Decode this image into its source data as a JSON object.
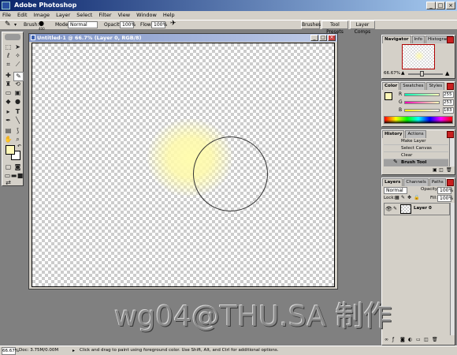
{
  "app": {
    "title": "Adobe Photoshop"
  },
  "window_controls": {
    "minimize": "_",
    "maximize": "□",
    "close": "×"
  },
  "menu": [
    "File",
    "Edit",
    "Image",
    "Layer",
    "Select",
    "Filter",
    "View",
    "Window",
    "Help"
  ],
  "options": {
    "brush_label": "Brush:",
    "brush_size": "400",
    "mode_label": "Mode:",
    "mode_value": "Normal",
    "opacity_label": "Opacity:",
    "opacity_value": "100%",
    "flow_label": "Flow:",
    "flow_value": "100%",
    "well_tabs": [
      "Brushes",
      "Tool Presets",
      "Layer Comps"
    ]
  },
  "document": {
    "title": "Untitled-1 @ 66.7% (Layer 0, RGB/8)"
  },
  "colors": {
    "foreground": "#fff8b8",
    "background": "#ffffff"
  },
  "navigator": {
    "tabs": [
      "Navigator",
      "Info",
      "Histogram"
    ],
    "zoom": "66.67%"
  },
  "color_panel": {
    "tabs": [
      "Color",
      "Swatches",
      "Styles"
    ],
    "channels": [
      {
        "label": "R",
        "value": "255"
      },
      {
        "label": "G",
        "value": "253"
      },
      {
        "label": "B",
        "value": "183"
      }
    ]
  },
  "history": {
    "tabs": [
      "History",
      "Actions"
    ],
    "items": [
      "Make Layer",
      "Select Canvas",
      "Clear",
      "Brush Tool"
    ]
  },
  "layers": {
    "tabs": [
      "Layers",
      "Channels",
      "Paths"
    ],
    "blend_mode": "Normal",
    "opacity_label": "Opacity:",
    "opacity_value": "100%",
    "lock_label": "Lock:",
    "fill_label": "Fill:",
    "fill_value": "100%",
    "items": [
      {
        "name": "Layer 0"
      }
    ]
  },
  "watermark": "wg04@THU.SA 制作",
  "status": {
    "zoom": "66.67%",
    "doc": "Doc: 3.75M/0.00M",
    "message": "Click and drag to paint using foreground color. Use Shift, Alt, and Ctrl for additional options."
  }
}
